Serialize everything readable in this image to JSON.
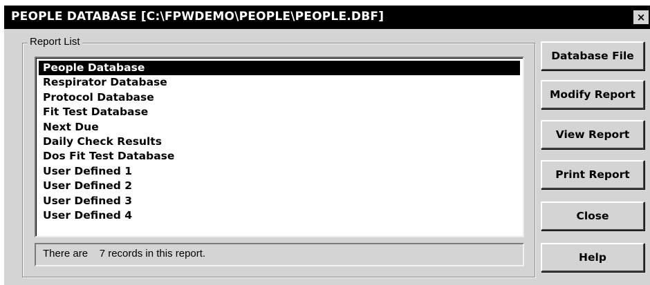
{
  "window": {
    "title": "PEOPLE DATABASE [C:\\FPWDEMO\\PEOPLE\\PEOPLE.DBF]",
    "close_glyph": "×"
  },
  "report_list": {
    "label": "Report List",
    "items": [
      "People Database",
      "Respirator Database",
      "Protocol Database",
      "Fit Test Database",
      "Next Due",
      "Daily Check Results",
      "Dos Fit Test Database",
      "User Defined 1",
      "User Defined 2",
      "User Defined 3",
      "User Defined 4"
    ],
    "selected_index": 0
  },
  "status": {
    "text": "There are    7 records in this report."
  },
  "buttons": {
    "database_file": "Database File",
    "modify_report": "Modify Report",
    "view_report": "View Report",
    "print_report": "Print Report",
    "close": "Close",
    "help": "Help"
  },
  "colors": {
    "title_bar": "#000000",
    "dialog_face": "#d4d4d4",
    "selection": "#000000"
  }
}
